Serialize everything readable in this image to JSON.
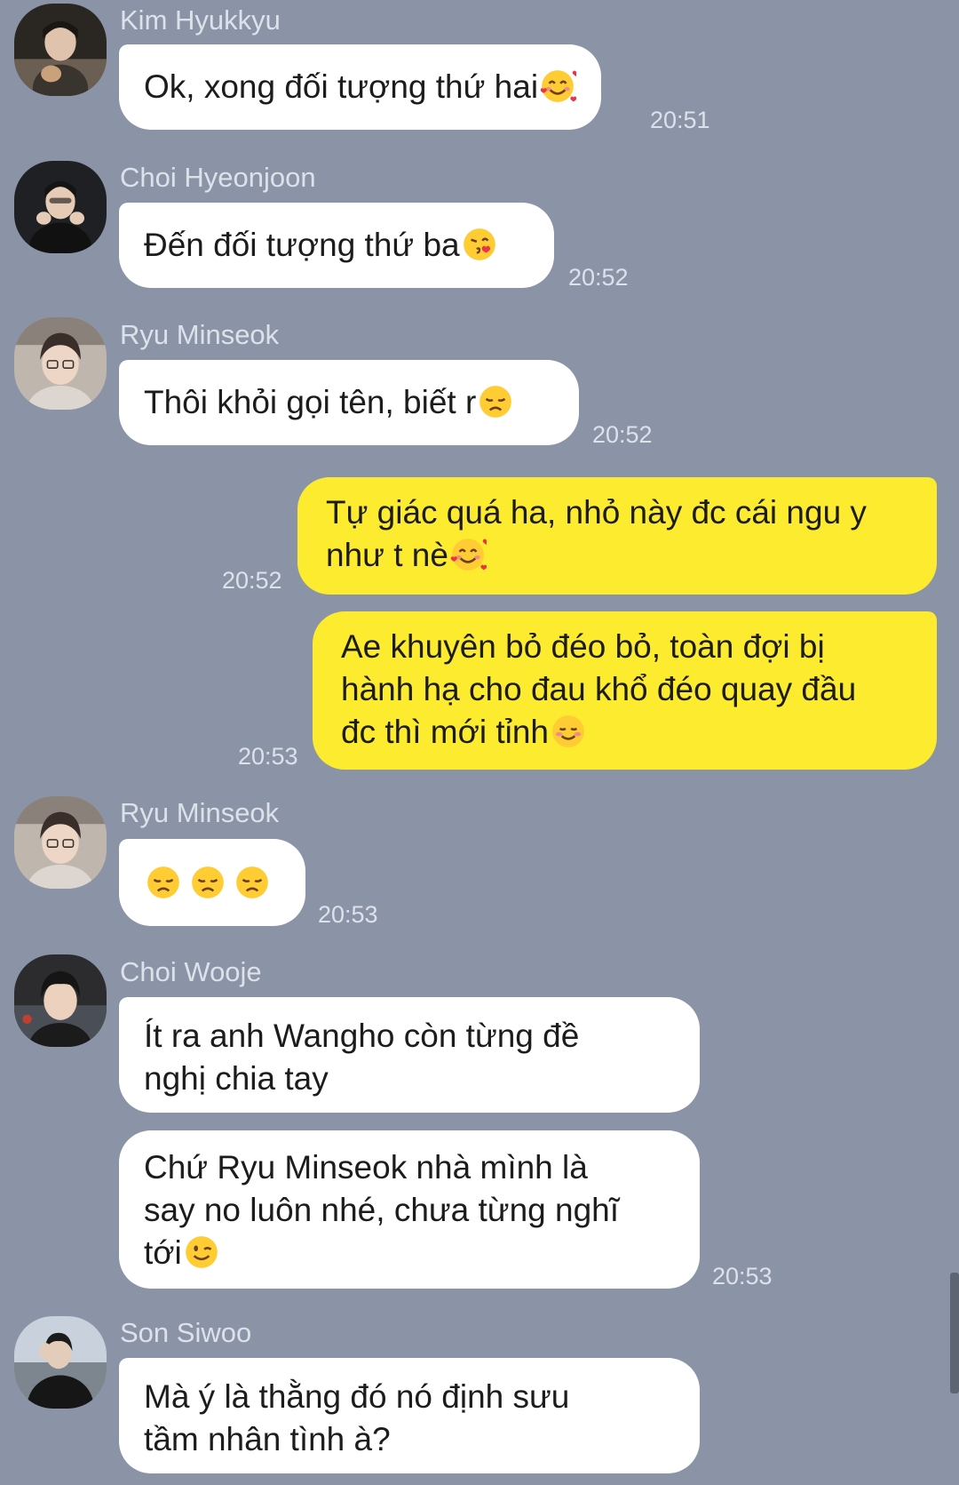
{
  "colors": {
    "background": "#8a94a6",
    "incoming_bubble": "#ffffff",
    "outgoing_bubble": "#fdeb30",
    "meta_text": "#dde2ea"
  },
  "messages": [
    {
      "sender": "Kim Hyukkyu",
      "text": "Ok, xong đối tượng thứ hai",
      "emoji": "smiling-face-with-hearts",
      "time": "20:51"
    },
    {
      "sender": "Choi Hyeonjoon",
      "text": "Đến đối tượng thứ ba",
      "emoji": "face-blowing-kiss",
      "time": "20:52"
    },
    {
      "sender": "Ryu Minseok",
      "text": "Thôi khỏi gọi tên, biết r",
      "emoji": "disappointed-face",
      "time": "20:52"
    },
    {
      "outgoing": true,
      "lines": [
        "Tự giác quá ha, nhỏ này đc cái ngu y",
        "như t nè"
      ],
      "emoji": "smiling-face-with-hearts",
      "time": "20:52"
    },
    {
      "outgoing": true,
      "lines": [
        "Ae khuyên bỏ đéo bỏ, toàn đợi bị",
        "hành hạ cho đau khổ đéo quay đầu",
        "đc thì mới tỉnh"
      ],
      "emoji": "smiling-face",
      "time": "20:53"
    },
    {
      "sender": "Ryu Minseok",
      "emojis": [
        "disappointed-face",
        "disappointed-face",
        "disappointed-face"
      ],
      "time": "20:53"
    },
    {
      "sender": "Choi Wooje",
      "lines": [
        "Ít ra anh Wangho còn từng đề",
        "nghị chia tay"
      ]
    },
    {
      "lines": [
        "Chứ Ryu Minseok nhà mình là",
        "say no luôn nhé, chưa từng nghĩ",
        "tới"
      ],
      "emoji": "winking-face",
      "time": "20:53"
    },
    {
      "sender": "Son Siwoo",
      "lines": [
        "Mà ý là thằng đó nó định sưu",
        "tầm nhân tình à?"
      ]
    }
  ]
}
